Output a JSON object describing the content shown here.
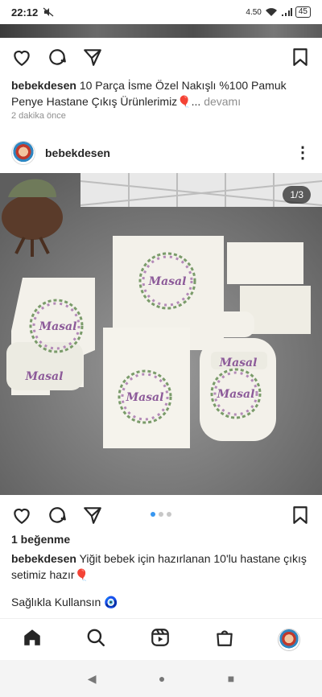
{
  "status": {
    "time": "22:12",
    "network_speed": "4.50",
    "battery": "45"
  },
  "post1": {
    "username": "bebekdesen",
    "caption": "10 Parça İsme Özel Nakışlı %100 Pamuk Penye Hastane Çıkış Ürünlerimiz🎈...",
    "more": "devamı",
    "time_ago": "2 dakika önce"
  },
  "post2": {
    "username": "bebekdesen",
    "more_icon": "kebab-menu-icon",
    "page_counter": "1/3",
    "image_text": "Masal",
    "likes": "1 beğenme",
    "caption_user": "bebekdesen",
    "caption": "Yiğit bebek için hazırlanan 10'lu hastane çıkış setimiz hazır🎈",
    "caption_line2": "Sağlıkla Kullansın 🧿"
  },
  "icons": [
    "heart-icon",
    "comment-icon",
    "share-icon",
    "bookmark-icon",
    "home-icon",
    "search-icon",
    "reels-icon",
    "shop-icon"
  ],
  "android_nav": {
    "back": "◀",
    "home": "●",
    "recents": "■"
  }
}
